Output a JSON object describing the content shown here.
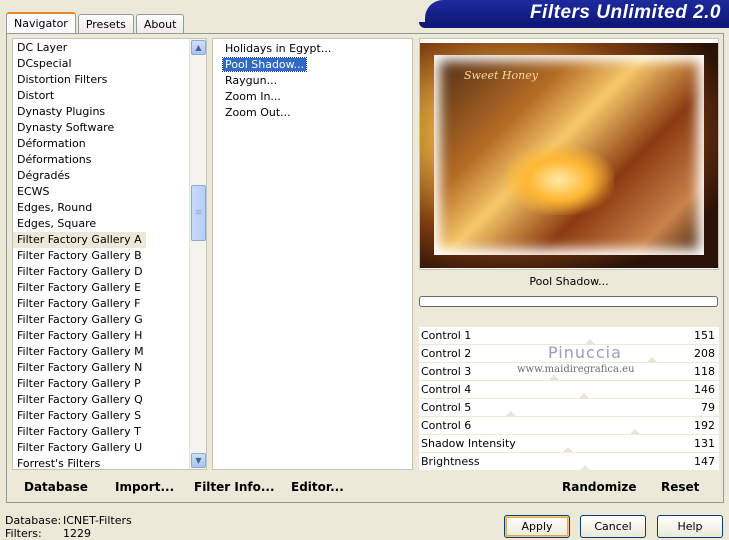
{
  "app": {
    "title": "Filters Unlimited 2.0"
  },
  "tabs": [
    {
      "label": "Navigator",
      "active": true
    },
    {
      "label": "Presets",
      "active": false
    },
    {
      "label": "About",
      "active": false
    }
  ],
  "categories": {
    "items": [
      "DC Layer",
      "DCspecial",
      "Distortion Filters",
      "Distort",
      "Dynasty Plugins",
      "Dynasty Software",
      "Déformation",
      "Déformations",
      "Dégradés",
      "ECWS",
      "Edges, Round",
      "Edges, Square",
      "Filter Factory Gallery A",
      "Filter Factory Gallery B",
      "Filter Factory Gallery D",
      "Filter Factory Gallery E",
      "Filter Factory Gallery F",
      "Filter Factory Gallery G",
      "Filter Factory Gallery H",
      "Filter Factory Gallery M",
      "Filter Factory Gallery N",
      "Filter Factory Gallery P",
      "Filter Factory Gallery Q",
      "Filter Factory Gallery S",
      "Filter Factory Gallery T",
      "Filter Factory Gallery U",
      "Forrest's Filters"
    ],
    "selected_index": 12
  },
  "filters": {
    "items": [
      "Holidays in Egypt...",
      "Pool Shadow...",
      "Raygun...",
      "Zoom In...",
      "Zoom Out..."
    ],
    "selected_index": 1
  },
  "preview": {
    "filter_name": "Pool Shadow...",
    "image_text": "Sweet Honey",
    "progress": 0
  },
  "controls": [
    {
      "name": "Control 1",
      "value": "151"
    },
    {
      "name": "Control 2",
      "value": "208"
    },
    {
      "name": "Control 3",
      "value": "118"
    },
    {
      "name": "Control 4",
      "value": "146"
    },
    {
      "name": "Control 5",
      "value": "79"
    },
    {
      "name": "Control 6",
      "value": "192"
    },
    {
      "name": "Shadow Intensity",
      "value": "131"
    },
    {
      "name": "Brightness",
      "value": "147"
    }
  ],
  "watermark": {
    "name": "Pinuccia",
    "url": "www.maidiregrafica.eu"
  },
  "toolbar": {
    "database": "Database",
    "import": "Import...",
    "filter_info": "Filter Info...",
    "editor": "Editor...",
    "randomize": "Randomize",
    "reset": "Reset"
  },
  "status": {
    "database_label": "Database:",
    "database_value": "ICNET-Filters",
    "filters_label": "Filters:",
    "filters_value": "1229"
  },
  "buttons": {
    "apply": "Apply",
    "cancel": "Cancel",
    "help": "Help"
  },
  "colors": {
    "banner": "#0e1878",
    "selection": "#316ac5",
    "background": "#ece9d8"
  }
}
